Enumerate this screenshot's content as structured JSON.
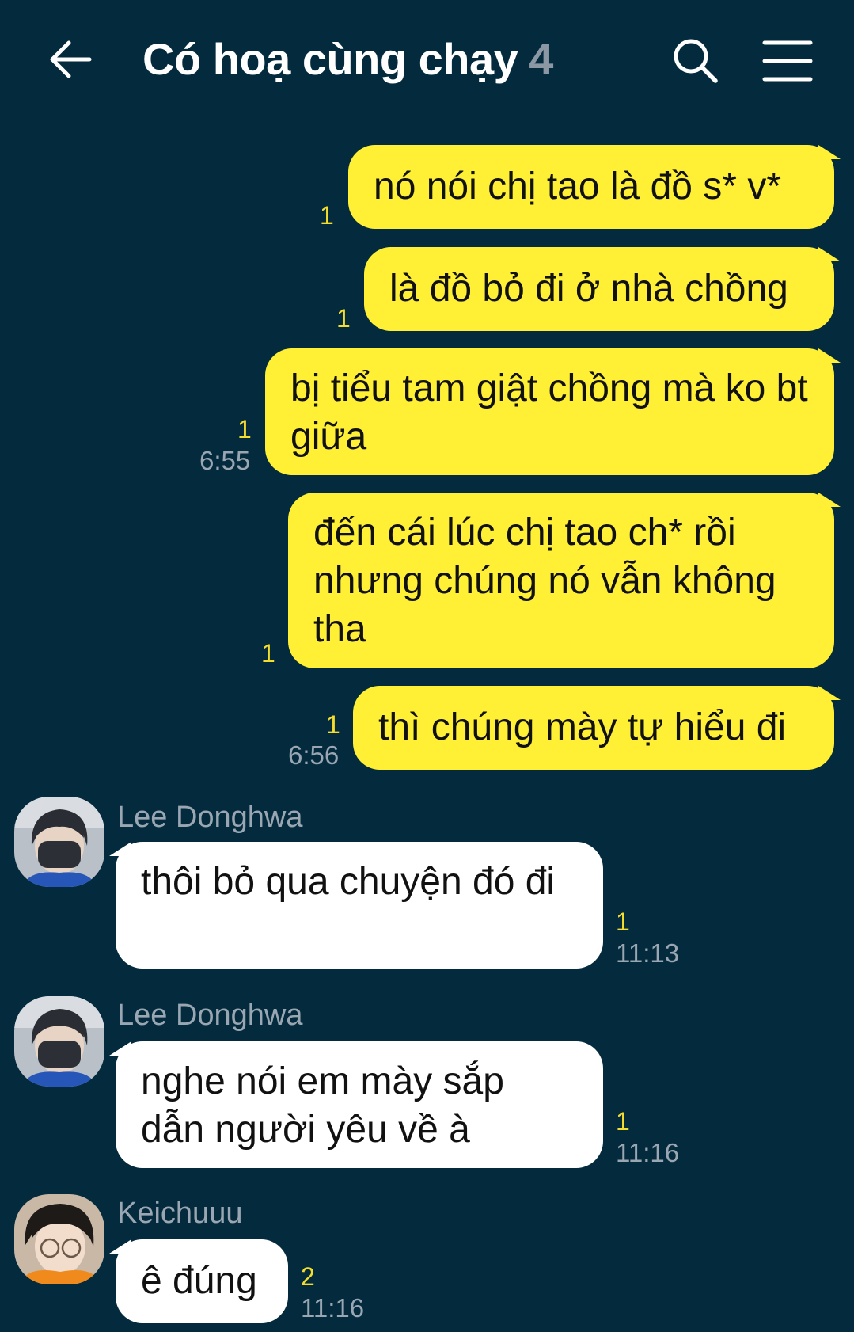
{
  "header": {
    "title": "Có hoạ cùng chạy",
    "member_count": "4"
  },
  "messages": [
    {
      "text": "nó nói chị tao là đồ s* v*",
      "unread": "1"
    },
    {
      "text": "là đồ bỏ đi ở nhà chồng",
      "unread": "1"
    },
    {
      "text": "bị tiểu tam giật chồng mà ko bt giữa",
      "unread": "1",
      "time": "6:55"
    },
    {
      "text": "đến cái lúc chị tao ch* rồi nhưng chúng nó vẫn không tha",
      "unread": "1"
    },
    {
      "text": "thì chúng mày tự hiểu đi",
      "unread": "1",
      "time": "6:56"
    },
    {
      "sender": "Lee Donghwa",
      "text": "thôi bỏ qua chuyện đó đi",
      "unread": "1",
      "time": "11:13"
    },
    {
      "sender": "Lee Donghwa",
      "text": "nghe nói em mày sắp dẫn người yêu về à",
      "unread": "1",
      "time": "11:16"
    },
    {
      "sender": "Keichuuu",
      "text": "ê đúng",
      "unread": "2",
      "time": "11:16"
    }
  ]
}
